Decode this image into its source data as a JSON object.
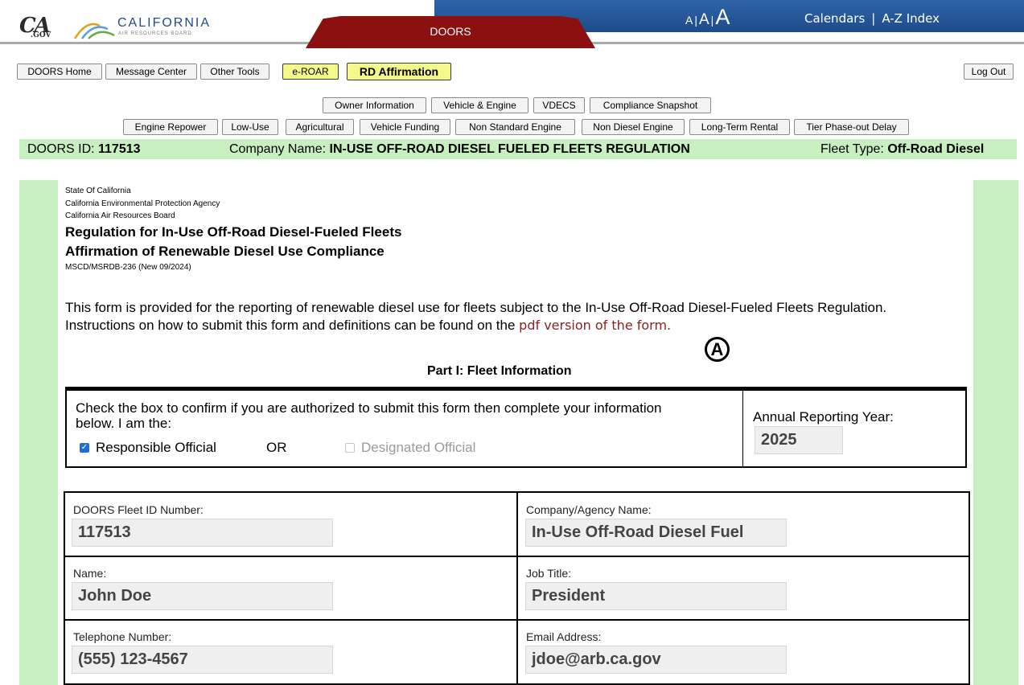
{
  "header": {
    "cagov_logo": "CA",
    "cagov_sub": ".GOV",
    "agency_name": "CALIFORNIA",
    "agency_sub": "AIR RESOURCES BOARD",
    "app_tab": "DOORS",
    "font_size": {
      "small": "A",
      "medium": "A",
      "large": "A",
      "sep": "|"
    },
    "links": {
      "calendars": "Calendars",
      "separator": "|",
      "az_index": "A-Z Index"
    }
  },
  "toolbar": {
    "doors_home": "DOORS Home",
    "message_center": "Message Center",
    "other_tools": "Other Tools",
    "eroar": "e-ROAR",
    "rd_affirmation": "RD Affirmation",
    "log_out": "Log Out"
  },
  "subnav_row1": [
    "Owner Information",
    "Vehicle & Engine",
    "VDECS",
    "Compliance Snapshot"
  ],
  "subnav_row2": [
    "Engine Repower",
    "Low-Use",
    "Agricultural",
    "Vehicle Funding",
    "Non Standard Engine",
    "Non Diesel Engine",
    "Long-Term Rental",
    "Tier Phase-out Delay"
  ],
  "info_band": {
    "doors_id_label": "DOORS ID: ",
    "doors_id": "117513",
    "company_label": "Company Name: ",
    "company": "IN-USE OFF-ROAD DIESEL FUELED FLEETS REGULATION",
    "fleet_type_label": "Fleet Type: ",
    "fleet_type": "Off-Road Diesel"
  },
  "form": {
    "agency_lines": [
      "State Of California",
      "California Environmental Protection Agency",
      "California Air Resources Board"
    ],
    "title1": "Regulation for In-Use Off-Road Diesel-Fueled Fleets",
    "title2": "Affirmation of Renewable Diesel Use Compliance",
    "form_code": "MSCD/MSRDB-236 (New 09/2024)",
    "intro_text": "This form is provided for the reporting of renewable diesel use for fleets subject to the In-Use Off-Road Diesel-Fueled Fleets Regulation. Instructions on how to submit this form and definitions can be found on the ",
    "intro_link": "pdf version of the form.",
    "callout": "A",
    "part1_title": "Part I: Fleet Information",
    "authorize_text": "Check the box to confirm if you are authorized to submit this form then complete your information below. I am the:",
    "responsible_official": "Responsible Official",
    "or_text": "OR",
    "designated_official": "Designated Official",
    "responsible_checked": true,
    "designated_checked": false,
    "annual_year_label": "Annual Reporting Year:",
    "annual_year": "2025",
    "fleet_id_label": "DOORS Fleet ID Number:",
    "fleet_id": "117513",
    "company_label": "Company/Agency Name:",
    "company_value": "In-Use Off-Road Diesel Fuel",
    "name_label": "Name:",
    "name_value": "John Doe",
    "job_label": "Job Title:",
    "job_value": "President",
    "phone_label": "Telephone Number:",
    "phone_value": "(555) 123-4567",
    "email_label": "Email Address:",
    "email_value": "jdoe@arb.ca.gov"
  }
}
